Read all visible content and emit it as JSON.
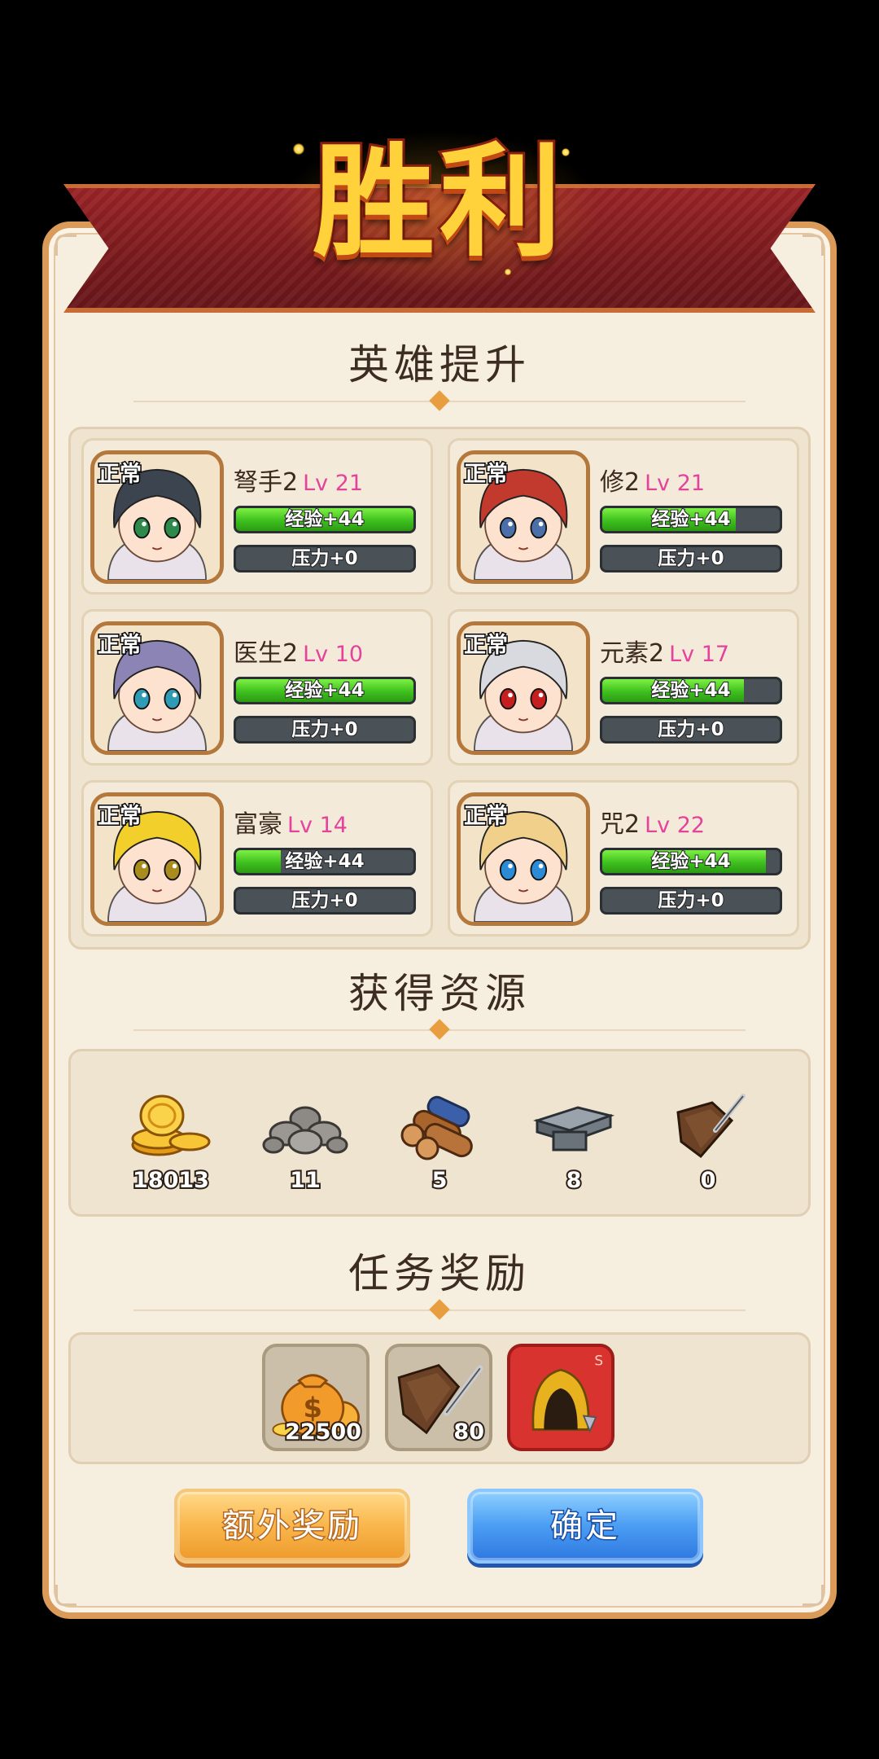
{
  "header": {
    "title": "胜利"
  },
  "sections": {
    "heroes": "英雄提升",
    "resources": "获得资源",
    "rewards": "任务奖励"
  },
  "heroes": [
    {
      "status": "正常",
      "name": "弩手2",
      "level": "Lv 21",
      "exp": "经验+44",
      "stress": "压力+0",
      "exp_fill": 1.0,
      "hair": "#3c4450",
      "eyes": "#2d8a4a"
    },
    {
      "status": "正常",
      "name": "修2",
      "level": "Lv 21",
      "exp": "经验+44",
      "stress": "压力+0",
      "exp_fill": 0.75,
      "hair": "#c23a2e",
      "eyes": "#4b6fa8"
    },
    {
      "status": "正常",
      "name": "医生2",
      "level": "Lv 10",
      "exp": "经验+44",
      "stress": "压力+0",
      "exp_fill": 1.0,
      "hair": "#8c84b5",
      "eyes": "#2f9bb5"
    },
    {
      "status": "正常",
      "name": "元素2",
      "level": "Lv 17",
      "exp": "经验+44",
      "stress": "压力+0",
      "exp_fill": 0.8,
      "hair": "#d9d9e0",
      "eyes": "#c61f1f"
    },
    {
      "status": "正常",
      "name": "富豪",
      "level": "Lv 14",
      "exp": "经验+44",
      "stress": "压力+0",
      "exp_fill": 0.25,
      "hair": "#f2cf2a",
      "eyes": "#a98b1e"
    },
    {
      "status": "正常",
      "name": "咒2",
      "level": "Lv 22",
      "exp": "经验+44",
      "stress": "压力+0",
      "exp_fill": 0.92,
      "hair": "#f0d08a",
      "eyes": "#2c8bd6"
    }
  ],
  "resources": [
    {
      "icon": "gold-coins-icon",
      "count": "18013"
    },
    {
      "icon": "stone-icon",
      "count": "11"
    },
    {
      "icon": "wood-logs-icon",
      "count": "5"
    },
    {
      "icon": "iron-ingot-icon",
      "count": "8"
    },
    {
      "icon": "leather-hide-icon",
      "count": "0"
    }
  ],
  "rewards": [
    {
      "icon": "money-bag-icon",
      "count": "22500"
    },
    {
      "icon": "leather-hide-icon",
      "count": "80"
    },
    {
      "icon": "helmet-item-icon",
      "count": ""
    }
  ],
  "buttons": {
    "extra": "额外奖励",
    "confirm": "确定"
  },
  "colors": {
    "banner": "#8a1f22",
    "panel": "#f6eede",
    "level_text": "#e5439b",
    "exp_bar": "#3ec01e",
    "confirm_button": "#4a9df3",
    "extra_button": "#f9b64b"
  }
}
